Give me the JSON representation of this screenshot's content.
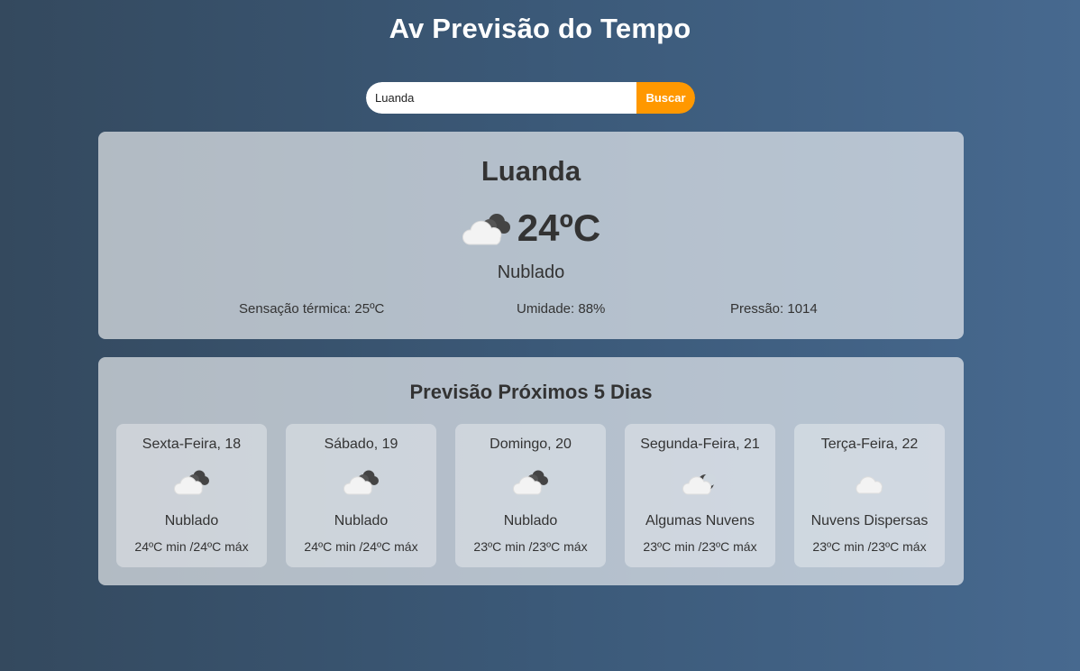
{
  "app": {
    "title": "Av Previsão do Tempo"
  },
  "search": {
    "value": "Luanda",
    "button_label": "Buscar"
  },
  "current": {
    "city": "Luanda",
    "temperature": "24ºC",
    "icon": "broken-clouds-icon",
    "description": "Nublado",
    "feels_like": "Sensação térmica: 25ºC",
    "humidity": "Umidade: 88%",
    "pressure": "Pressão: 1014"
  },
  "forecast": {
    "title": "Previsão Próximos 5 Dias",
    "days": [
      {
        "day": "Sexta-Feira, 18",
        "icon": "broken-clouds-icon",
        "description": "Nublado",
        "temps": "24ºC min /24ºC máx"
      },
      {
        "day": "Sábado, 19",
        "icon": "broken-clouds-icon",
        "description": "Nublado",
        "temps": "24ºC min /24ºC máx"
      },
      {
        "day": "Domingo, 20",
        "icon": "broken-clouds-icon",
        "description": "Nublado",
        "temps": "23ºC min /23ºC máx"
      },
      {
        "day": "Segunda-Feira, 21",
        "icon": "few-clouds-night-icon",
        "description": "Algumas Nuvens",
        "temps": "23ºC min /23ºC máx"
      },
      {
        "day": "Terça-Feira, 22",
        "icon": "scattered-clouds-icon",
        "description": "Nuvens Dispersas",
        "temps": "23ºC min /23ºC máx"
      }
    ]
  },
  "colors": {
    "accent": "#ff9800",
    "background_start": "#34495e",
    "background_end": "#47698f"
  }
}
